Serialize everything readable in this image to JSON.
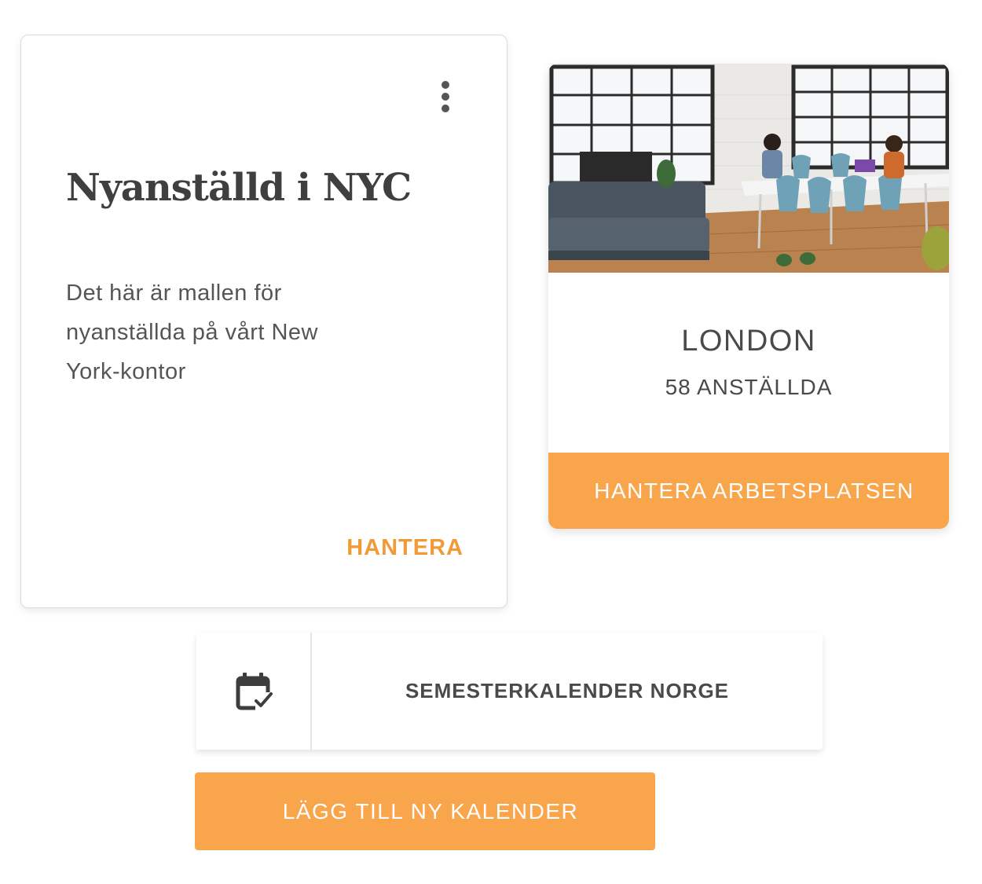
{
  "template_card": {
    "title": "Nyanställd i NYC",
    "description": "Det här är mallen för nyanställda på vårt New York-kontor",
    "manage_label": "HANTERA",
    "menu_icon": "kebab-menu-icon"
  },
  "workplace_card": {
    "photo": "office-photo",
    "name": "LONDON",
    "employees": "58 ANSTÄLLDA",
    "manage_button_label": "HANTERA ARBETSPLATSEN"
  },
  "calendar": {
    "icon": "calendar-check-icon",
    "name": "SEMESTERKALENDER NORGE"
  },
  "add_calendar_button_label": "LÄGG TILL NY KALENDER",
  "colors": {
    "accent": "#f9a54c",
    "accent_text": "#f29a38",
    "text": "#4a4a4a"
  }
}
